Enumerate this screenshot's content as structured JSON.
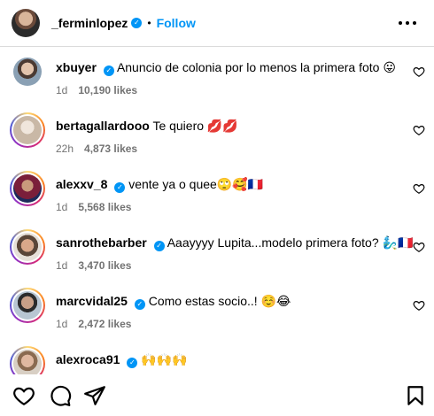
{
  "post": {
    "username": "_ferminlopez",
    "separator": "•",
    "follow_label": "Follow"
  },
  "comments": [
    {
      "user": "xbuyer",
      "verified": true,
      "text": "Anuncio de colonia por lo menos la primera foto 😛",
      "time": "1d",
      "likes": "10,190 likes"
    },
    {
      "user": "bertagallardooo",
      "verified": false,
      "text": "Te quiero 💋💋",
      "time": "22h",
      "likes": "4,873 likes"
    },
    {
      "user": "alexxv_8",
      "verified": true,
      "text": "vente ya o quee🙄🥰🇫🇷",
      "time": "1d",
      "likes": "5,568 likes"
    },
    {
      "user": "sanrothebarber",
      "verified": true,
      "text": "Aaayyyy Lupita...modelo primera foto? 🧞‍♂️🇫🇷",
      "time": "1d",
      "likes": "3,470 likes"
    },
    {
      "user": "marcvidal25",
      "verified": true,
      "text": "Como estas socio..! ☺️😂",
      "time": "1d",
      "likes": "2,472 likes"
    },
    {
      "user": "alexroca91",
      "verified": true,
      "text": "🙌🙌🙌",
      "time": "",
      "likes": ""
    }
  ],
  "colors": {
    "accent": "#0095f6",
    "muted": "#737373",
    "divider": "#dbdbdb"
  },
  "icons": [
    "more-icon",
    "verified-icon",
    "heart-icon",
    "comment-icon",
    "share-icon",
    "bookmark-icon"
  ]
}
